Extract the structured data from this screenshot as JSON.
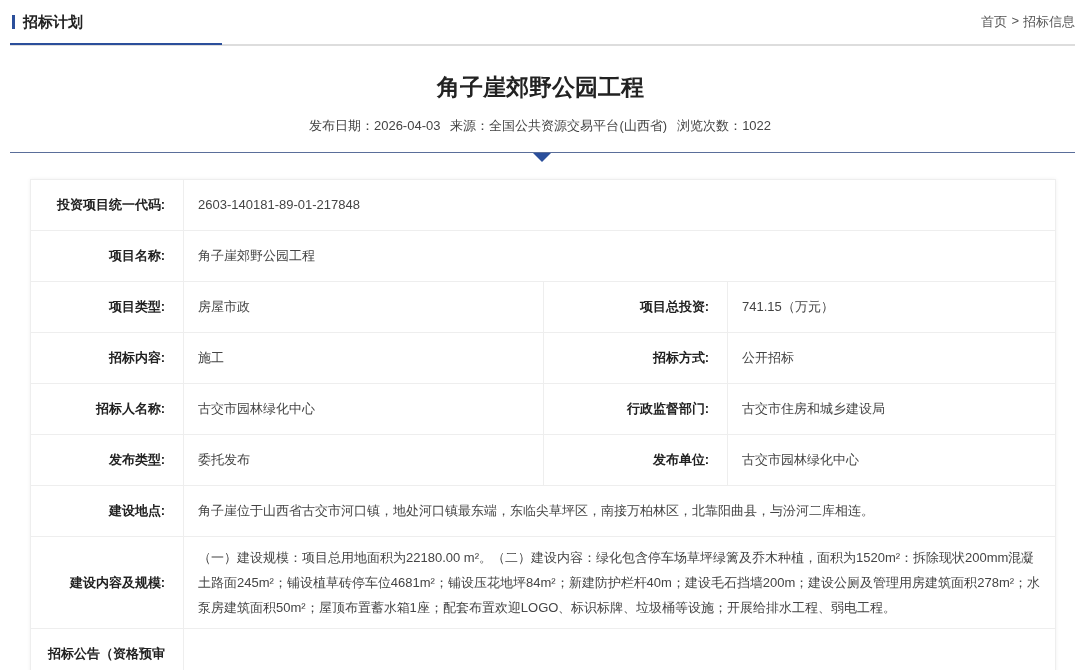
{
  "header": {
    "section_title": "招标计划",
    "breadcrumb": [
      "首页",
      ">",
      "招标信息"
    ]
  },
  "article": {
    "title": "角子崖郊野公园工程",
    "meta": [
      "发布日期：2026-04-03",
      "来源：全国公共资源交易平台(山西省)",
      "浏览次数：1022"
    ]
  },
  "table": {
    "rows": [
      {
        "cells": [
          {
            "label": "投资项目统一代码:",
            "value": "2603-140181-89-01-217848"
          }
        ]
      },
      {
        "cells": [
          {
            "label": "项目名称:",
            "value": "角子崖郊野公园工程"
          }
        ]
      },
      {
        "cells": [
          {
            "label": "项目类型:",
            "value": "房屋市政"
          },
          {
            "label": "项目总投资:",
            "value": "741.15（万元）"
          }
        ]
      },
      {
        "cells": [
          {
            "label": "招标内容:",
            "value": "施工"
          },
          {
            "label": "招标方式:",
            "value": "公开招标"
          }
        ]
      },
      {
        "cells": [
          {
            "label": "招标人名称:",
            "value": "古交市园林绿化中心"
          },
          {
            "label": "行政监督部门:",
            "value": "古交市住房和城乡建设局"
          }
        ]
      },
      {
        "cells": [
          {
            "label": "发布类型:",
            "value": "委托发布"
          },
          {
            "label": "发布单位:",
            "value": "古交市园林绿化中心"
          }
        ]
      },
      {
        "cells": [
          {
            "label": "建设地点:",
            "value": "角子崖位于山西省古交市河口镇，地处河口镇最东端，东临尖草坪区，南接万柏林区，北靠阳曲县，与汾河二库相连。"
          }
        ]
      },
      {
        "cells": [
          {
            "label": "建设内容及规模:",
            "value": "（一）建设规模：项目总用地面积为22180.00 m²。（二）建设内容：绿化包含停车场草坪绿篱及乔木种植，面积为1520m²：拆除现状200mm混凝土路面245m²；铺设植草砖停车位4681m²；铺设压花地坪84m²；新建防护栏杆40m；建设毛石挡墙200m；建设公厕及管理用房建筑面积278m²；水泵房建筑面积50m²；屋顶布置蓄水箱1座；配套布置欢迎LOGO、标识标牌、垃圾桶等设施；开展给排水工程、弱电工程。"
          }
        ]
      },
      {
        "cells": [
          {
            "label": "招标公告（资格预审"
          }
        ]
      }
    ]
  }
}
